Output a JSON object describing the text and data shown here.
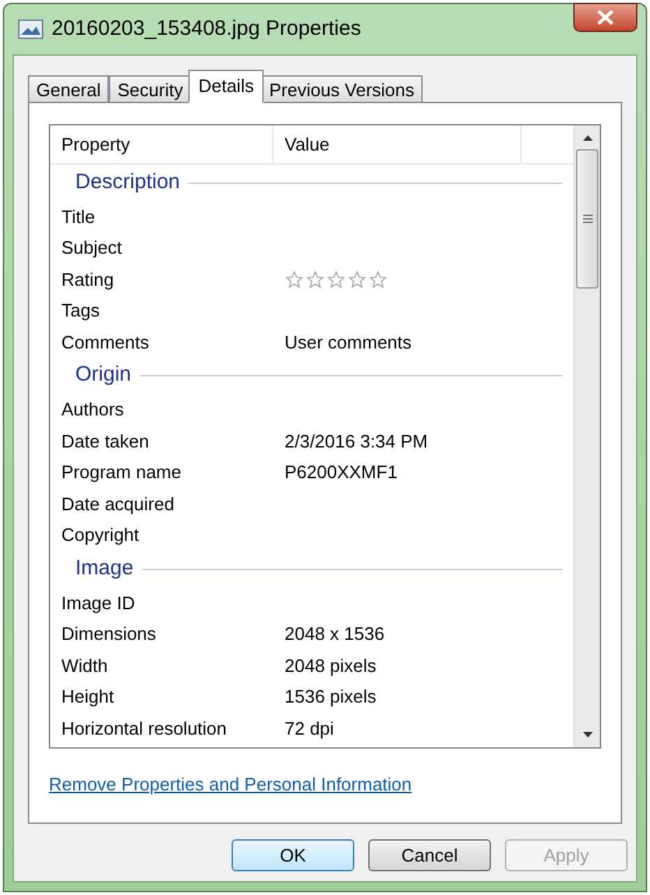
{
  "window": {
    "title": "20160203_153408.jpg Properties"
  },
  "tabs": [
    {
      "label": "General",
      "selected": false
    },
    {
      "label": "Security",
      "selected": false
    },
    {
      "label": "Details",
      "selected": true
    },
    {
      "label": "Previous Versions",
      "selected": false
    }
  ],
  "list": {
    "columns": [
      "Property",
      "Value"
    ],
    "groups": [
      {
        "title": "Description",
        "rows": [
          {
            "property": "Title"
          },
          {
            "property": "Subject"
          },
          {
            "property": "Rating",
            "stars": 0
          },
          {
            "property": "Tags"
          },
          {
            "property": "Comments",
            "value": "User comments"
          }
        ]
      },
      {
        "title": "Origin",
        "rows": [
          {
            "property": "Authors"
          },
          {
            "property": "Date taken",
            "value": "2/3/2016 3:34 PM"
          },
          {
            "property": "Program name",
            "value": "P6200XXMF1"
          },
          {
            "property": "Date acquired"
          },
          {
            "property": "Copyright"
          }
        ]
      },
      {
        "title": "Image",
        "rows": [
          {
            "property": "Image ID"
          },
          {
            "property": "Dimensions",
            "value": "2048 x 1536"
          },
          {
            "property": "Width",
            "value": "2048 pixels"
          },
          {
            "property": "Height",
            "value": "1536 pixels"
          },
          {
            "property": "Horizontal resolution",
            "value": "72 dpi"
          }
        ]
      }
    ]
  },
  "link": "Remove Properties and Personal Information",
  "buttons": [
    {
      "label": "OK",
      "default": true,
      "disabled": false
    },
    {
      "label": "Cancel",
      "default": false,
      "disabled": false
    },
    {
      "label": "Apply",
      "default": false,
      "disabled": true
    }
  ]
}
